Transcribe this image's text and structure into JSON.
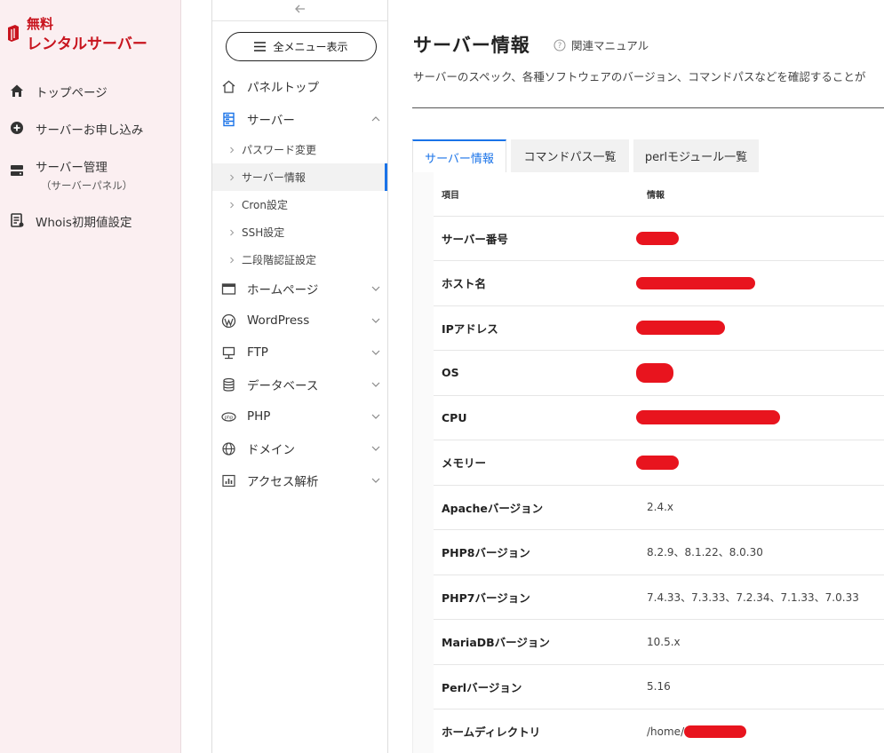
{
  "brand": {
    "line1": "無料",
    "line2": "レンタルサーバー",
    "color": "#c8141e"
  },
  "brand_nav": [
    {
      "label": "トップページ",
      "icon": "home-icon"
    },
    {
      "label": "サーバーお申し込み",
      "icon": "plus-circle-icon"
    },
    {
      "label": "サーバー管理",
      "sub": "（サーバーパネル）",
      "icon": "server-icon"
    },
    {
      "label": "Whois初期値設定",
      "icon": "id-card-icon"
    }
  ],
  "panel_nav": {
    "menu_button": "全メニュー表示",
    "top": "パネルトップ",
    "server": "サーバー",
    "server_sub": [
      "パスワード変更",
      "サーバー情報",
      "Cron設定",
      "SSH設定",
      "二段階認証設定"
    ],
    "homepage": "ホームページ",
    "wordpress": "WordPress",
    "ftp": "FTP",
    "database": "データベース",
    "php": "PHP",
    "domain": "ドメイン",
    "access": "アクセス解析",
    "accent": "#1a73e8"
  },
  "main": {
    "title": "サーバー情報",
    "help": "関連マニュアル",
    "description": "サーバーのスペック、各種ソフトウェアのバージョン、コマンドパスなどを確認することが",
    "tabs": [
      "サーバー情報",
      "コマンドパス一覧",
      "perlモジュール一覧"
    ],
    "table": {
      "headers": [
        "項目",
        "情報"
      ],
      "rows": [
        {
          "label": "サーバー番号",
          "value": ""
        },
        {
          "label": "ホスト名",
          "value": ""
        },
        {
          "label": "IPアドレス",
          "value": ""
        },
        {
          "label": "OS",
          "value": ""
        },
        {
          "label": "CPU",
          "value": ""
        },
        {
          "label": "メモリー",
          "value": ""
        },
        {
          "label": "Apacheバージョン",
          "value": "2.4.x"
        },
        {
          "label": "PHP8バージョン",
          "value": "8.2.9、8.1.22、8.0.30"
        },
        {
          "label": "PHP7バージョン",
          "value": "7.4.33、7.3.33、7.2.34、7.1.33、7.0.33"
        },
        {
          "label": "MariaDBバージョン",
          "value": "10.5.x"
        },
        {
          "label": "Perlバージョン",
          "value": "5.16"
        },
        {
          "label": "ホームディレクトリ",
          "value": "/home/"
        }
      ]
    },
    "redaction_color": "#e8141e"
  }
}
